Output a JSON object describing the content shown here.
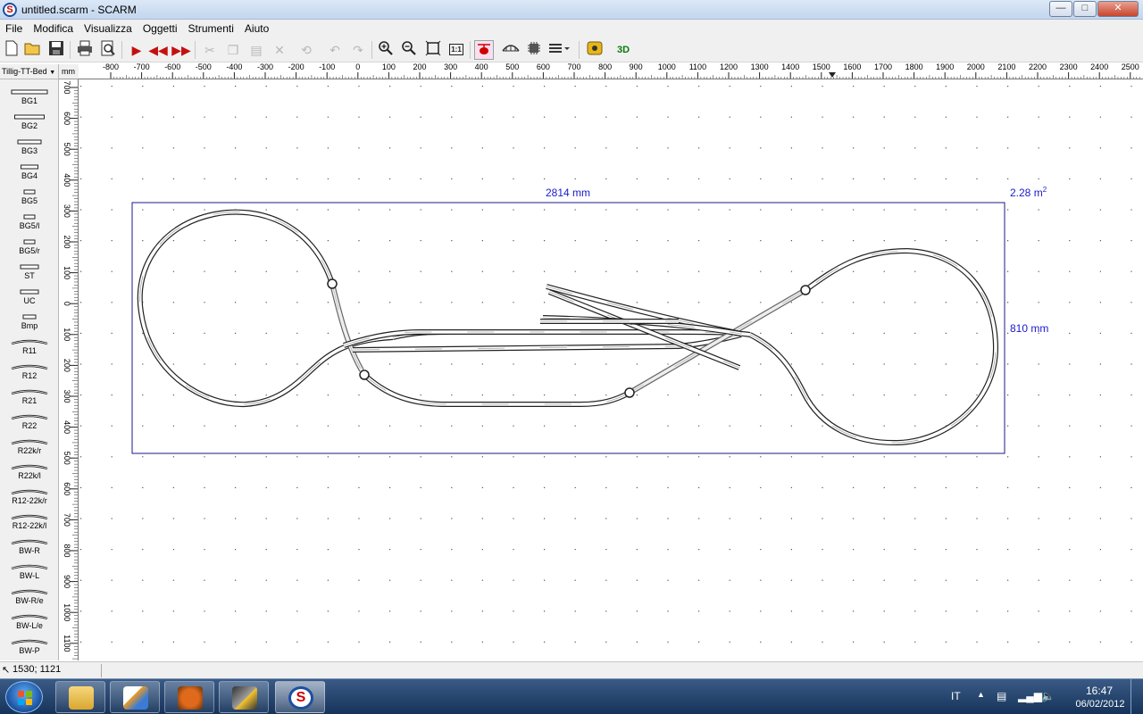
{
  "window": {
    "title": "untitled.scarm - SCARM",
    "app_icon": "S"
  },
  "menu": [
    "File",
    "Modifica",
    "Visualizza",
    "Oggetti",
    "Strumenti",
    "Aiuto"
  ],
  "toolbar": {
    "buttons": [
      "new-icon",
      "open-icon",
      "save-icon",
      "print-icon",
      "print-preview-icon",
      "play-icon",
      "rewind-icon",
      "forward-icon",
      "cut-icon",
      "copy-icon",
      "paste-icon",
      "delete-icon",
      "rotate-icon",
      "undo-icon",
      "redo-icon",
      "zoom-in-icon",
      "zoom-out-icon",
      "zoom-fit-icon",
      "zoom-1to1-icon",
      "helicopter-icon",
      "bridge-icon",
      "chip-icon",
      "layers-icon",
      "measure-icon",
      "3d-view-icon"
    ],
    "label_3d": "3D",
    "label_11": "1:1"
  },
  "library": {
    "selected": "Tillig-TT-Bed",
    "unit": "mm",
    "items": [
      "BG1",
      "BG2",
      "BG3",
      "BG4",
      "BG5",
      "BG5/l",
      "BG5/r",
      "ST",
      "UC",
      "Bmp",
      "R11",
      "R12",
      "R21",
      "R22",
      "R22k/r",
      "R22k/l",
      "R12-22k/r",
      "R12-22k/l",
      "BW-R",
      "BW-L",
      "BW-R/e",
      "BW-L/e",
      "BW-P"
    ]
  },
  "ruler": {
    "h_labels": [
      "-800",
      "-700",
      "-600",
      "-500",
      "-400",
      "-300",
      "-200",
      "-100",
      "0",
      "100",
      "200",
      "300",
      "400",
      "500",
      "600",
      "700",
      "800",
      "900",
      "1000",
      "1100",
      "1200",
      "1300",
      "1400",
      "1500",
      "1600",
      "1700",
      "1800",
      "1900",
      "2000",
      "2100",
      "2200",
      "2300",
      "2400",
      "2500"
    ],
    "v_labels": [
      "700",
      "600",
      "500",
      "400",
      "300",
      "200",
      "100",
      "0",
      "100",
      "200",
      "300",
      "400",
      "500",
      "600",
      "700",
      "800",
      "900",
      "1000",
      "1100"
    ]
  },
  "layout": {
    "width_label": "2814 mm",
    "height_label": "810 mm",
    "area_label": "2.28 m",
    "area_exp": "2",
    "track_color": "#222222",
    "box_color": "#1a1a8c"
  },
  "status": {
    "coords": "1530; 1121"
  },
  "taskbar": {
    "apps": [
      "explorer",
      "app2",
      "app3",
      "app4",
      "scarm"
    ],
    "lang": "IT",
    "time": "16:47",
    "date": "06/02/2012"
  }
}
